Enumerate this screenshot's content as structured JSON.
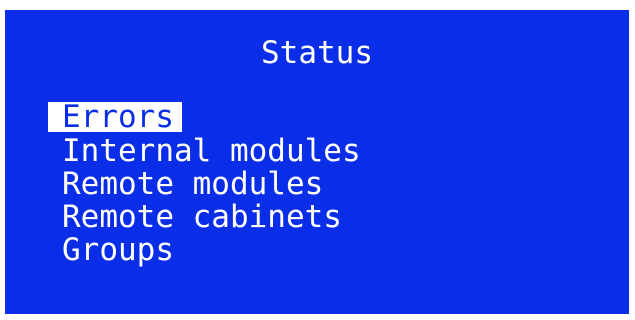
{
  "screen": {
    "title": "Status",
    "background_color": "#0a2ee8",
    "text_color": "#ffffff"
  },
  "menu": {
    "selected_index": 0,
    "items": [
      {
        "label": "Errors"
      },
      {
        "label": "Internal modules"
      },
      {
        "label": "Remote modules"
      },
      {
        "label": "Remote cabinets"
      },
      {
        "label": "Groups"
      }
    ]
  }
}
